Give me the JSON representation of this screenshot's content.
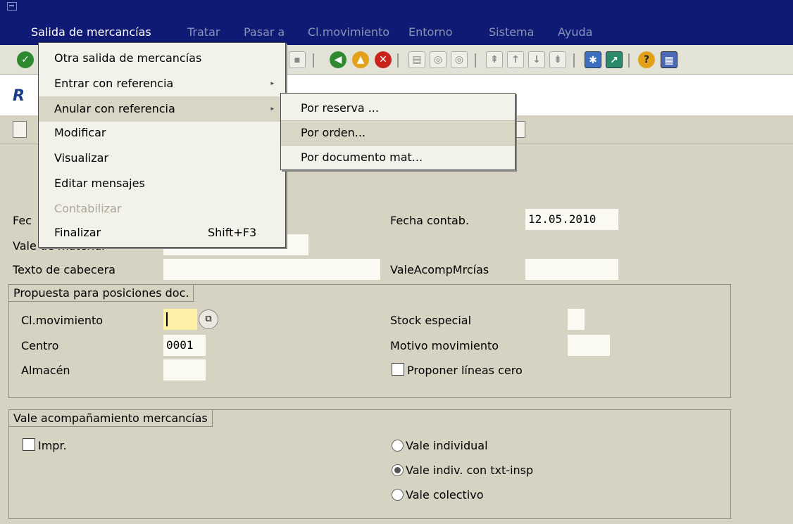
{
  "menubar": {
    "items": [
      "Salida de mercancías",
      "Tratar",
      "Pasar a",
      "Cl.movimiento",
      "Entorno",
      "Sistema",
      "Ayuda"
    ]
  },
  "title": "R",
  "dropdown": {
    "items": [
      {
        "label": "Otra salida de mercancías"
      },
      {
        "label": "Entrar con referencia",
        "arrow": "▸"
      },
      {
        "label": "Anular con referencia",
        "arrow": "▸"
      },
      {
        "label": "Modificar"
      },
      {
        "label": "Visualizar"
      },
      {
        "label": "Editar mensajes"
      },
      {
        "label": "Contabilizar"
      },
      {
        "label": "Finalizar",
        "accel": "Shift+F3"
      }
    ]
  },
  "submenu": {
    "items": [
      "Por reserva ...",
      "Por orden...",
      "Por documento mat..."
    ]
  },
  "header": {
    "fecha_doc_label": "Fec",
    "vale_material_label": "Vale de material",
    "texto_cabecera_label": "Texto de cabecera",
    "texto_cabecera_value": "",
    "fecha_contab_label": "Fecha contab.",
    "fecha_contab_value": "12.05.2010",
    "vale_acomp_label": "ValeAcompMrcías",
    "vale_acomp_value": ""
  },
  "propuesta": {
    "title": "Propuesta para posiciones doc.",
    "clmov_label": "Cl.movimiento",
    "clmov_value": "",
    "centro_label": "Centro",
    "centro_value": "0001",
    "almacen_label": "Almacén",
    "almacen_value": "",
    "stock_label": "Stock especial",
    "motivo_label": "Motivo movimiento",
    "proponer_label": "Proponer líneas cero"
  },
  "vale": {
    "title": "Vale acompañamiento mercancías",
    "impr_label": "Impr.",
    "radio1": "Vale individual",
    "radio2": "Vale indiv. con txt-insp",
    "radio3": "Vale colectivo"
  }
}
